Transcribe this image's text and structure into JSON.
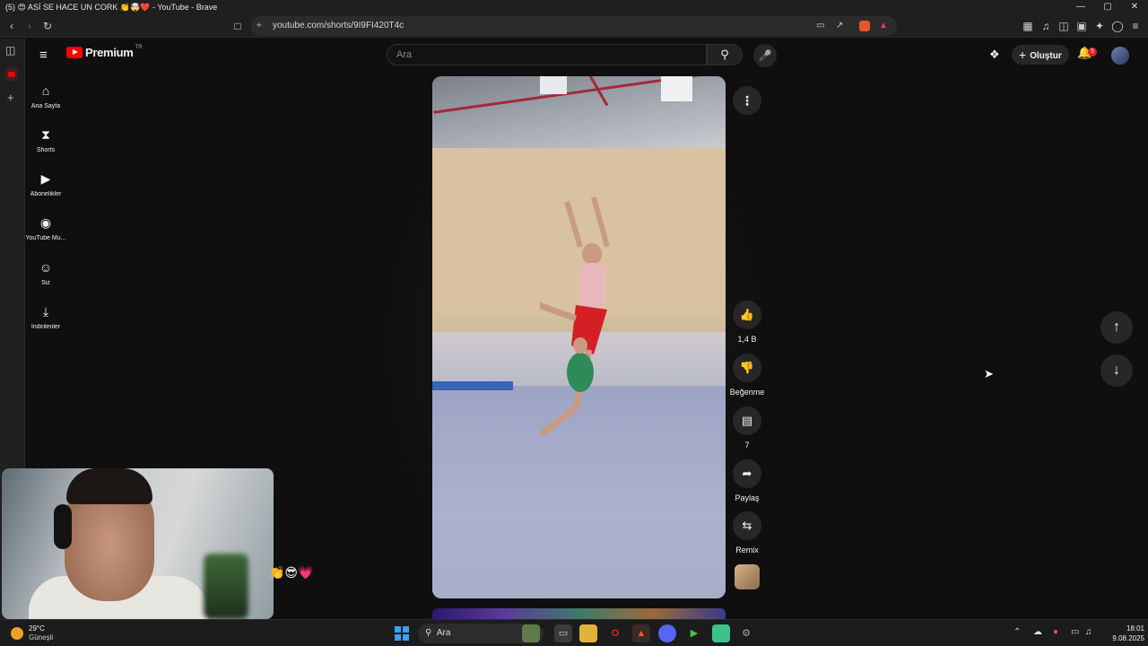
{
  "window": {
    "title": "(5) 😍 ASÍ SE HACE UN CORK 👏🤯❤️ - YouTube - Brave",
    "controls": {
      "minimize": "—",
      "maximize": "▢",
      "close": "✕"
    }
  },
  "browser": {
    "url": "youtube.com/shorts/9I9FI420T4c"
  },
  "header": {
    "logo_text": "Premium",
    "logo_region": "TR",
    "search_placeholder": "Ara",
    "create_label": "Oluştur",
    "notification_count": "5"
  },
  "nav": {
    "items": [
      {
        "label": "Ana Sayfa",
        "icon": "home-icon"
      },
      {
        "label": "Shorts",
        "icon": "shorts-icon"
      },
      {
        "label": "Abonelikler",
        "icon": "subscriptions-icon"
      },
      {
        "label": "YouTube Mu...",
        "icon": "youtube-music-icon"
      },
      {
        "label": "Siz",
        "icon": "you-icon"
      },
      {
        "label": "İndirilenler",
        "icon": "downloads-icon"
      }
    ]
  },
  "short": {
    "actions": {
      "like_count": "1,4 B",
      "dislike_label": "Beğenme",
      "comment_count": "7",
      "share_label": "Paylaş",
      "remix_label": "Remix"
    }
  },
  "overlay": {
    "emoji": "👏😎💗"
  },
  "taskbar": {
    "weather_temp": "29°C",
    "weather_desc": "Güneşli",
    "search_label": "Ara",
    "time": "18:01",
    "date": "9.08.2025"
  }
}
